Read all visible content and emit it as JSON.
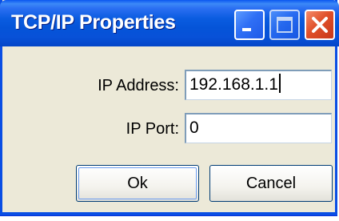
{
  "window": {
    "title": "TCP/IP Properties"
  },
  "titlebar_buttons": {
    "minimize_icon": "minimize-icon",
    "maximize_icon": "maximize-icon",
    "close_icon": "close-icon"
  },
  "form": {
    "ip_address_label": "IP Address:",
    "ip_address_value": "192.168.1.1",
    "ip_port_label": "IP Port:",
    "ip_port_value": "0"
  },
  "buttons": {
    "ok_label": "Ok",
    "cancel_label": "Cancel"
  },
  "colors": {
    "titlebar": "#0554d8",
    "close_button": "#e0502a",
    "window_bg": "#ece9d8"
  }
}
